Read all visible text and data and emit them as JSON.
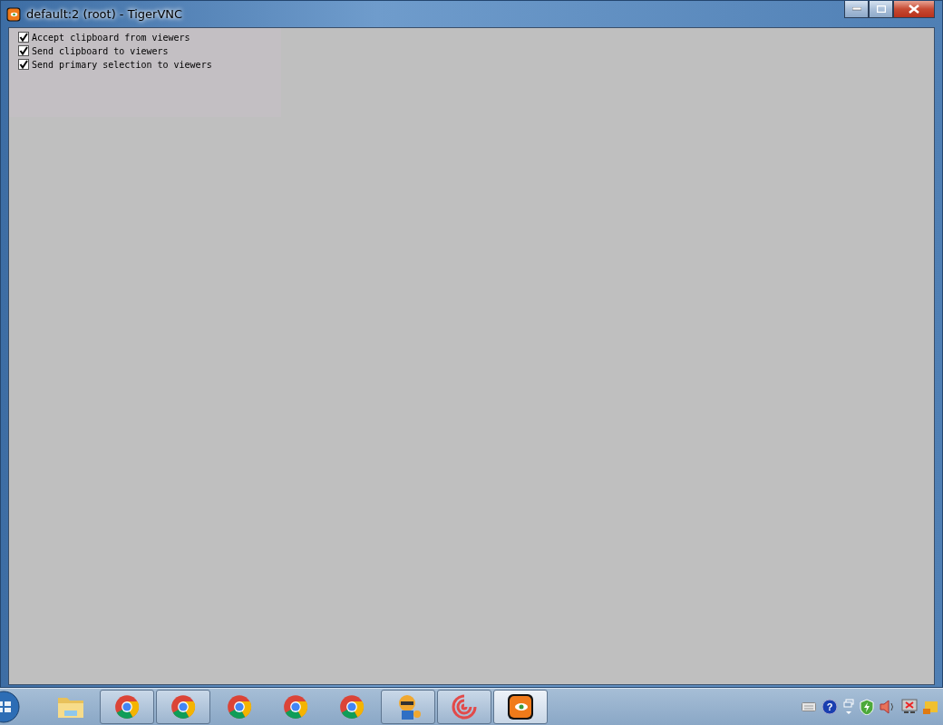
{
  "window": {
    "title": "default:2 (root) - TigerVNC"
  },
  "options": [
    {
      "label": "Accept clipboard from viewers",
      "checked": true
    },
    {
      "label": "Send clipboard to viewers",
      "checked": true
    },
    {
      "label": "Send primary selection to viewers",
      "checked": true
    }
  ],
  "taskbar": {
    "help_glyph": "?",
    "apps": [
      {
        "kind": "folder",
        "running": false,
        "selected": false
      },
      {
        "kind": "browser",
        "running": true,
        "selected": false
      },
      {
        "kind": "browser",
        "running": true,
        "selected": false
      },
      {
        "kind": "browser",
        "running": false,
        "selected": false
      },
      {
        "kind": "browser",
        "running": false,
        "selected": false
      },
      {
        "kind": "browser",
        "running": false,
        "selected": false
      },
      {
        "kind": "mascot",
        "running": true,
        "selected": false
      },
      {
        "kind": "swirl",
        "running": true,
        "selected": false
      },
      {
        "kind": "tiger",
        "running": true,
        "selected": true
      }
    ]
  }
}
